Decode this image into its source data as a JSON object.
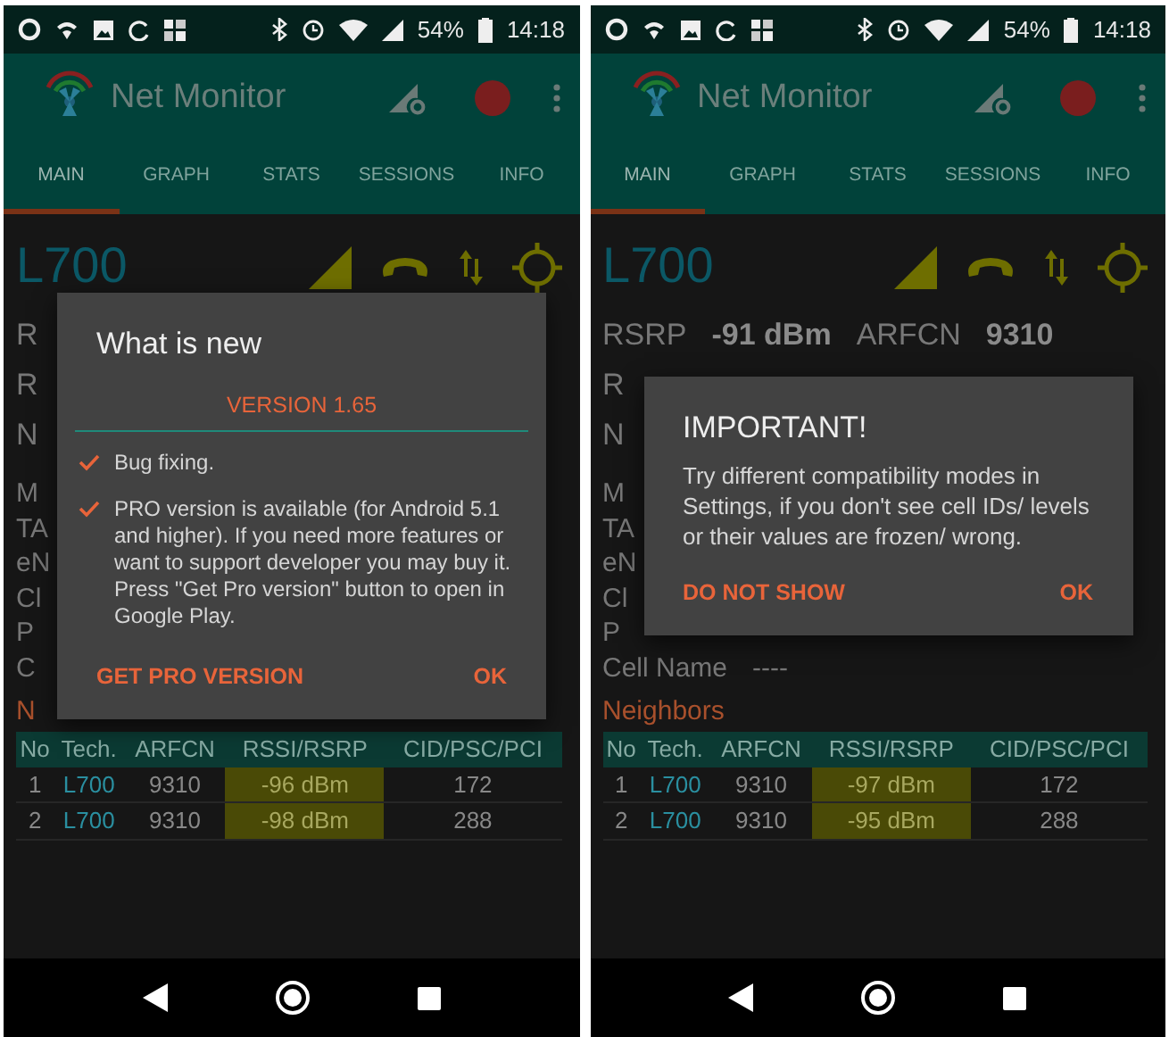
{
  "phones": [
    {
      "status_bar": {
        "battery": "54%",
        "time": "14:18"
      },
      "app_bar": {
        "title": "Net Monitor"
      },
      "tabs": [
        {
          "label": "MAIN",
          "selected": true
        },
        {
          "label": "GRAPH",
          "selected": false
        },
        {
          "label": "STATS",
          "selected": false
        },
        {
          "label": "SESSIONS",
          "selected": false
        },
        {
          "label": "INFO",
          "selected": false
        }
      ],
      "cell": {
        "tech": "L700"
      },
      "info_lines": [
        {
          "kind": "primary",
          "parts": [
            {
              "kind": "label",
              "text": "R"
            }
          ]
        },
        {
          "kind": "primary",
          "parts": [
            {
              "kind": "label",
              "text": "R"
            }
          ]
        },
        {
          "kind": "primary",
          "parts": [
            {
              "kind": "label",
              "text": "N"
            }
          ]
        },
        {
          "kind": "secondary",
          "parts": [
            {
              "kind": "label",
              "text": "M"
            }
          ]
        },
        {
          "kind": "secondary",
          "parts": [
            {
              "kind": "label",
              "text": "TA"
            }
          ]
        },
        {
          "kind": "secondary",
          "parts": [
            {
              "kind": "label",
              "text": "eN"
            }
          ]
        },
        {
          "kind": "secondary",
          "parts": [
            {
              "kind": "label",
              "text": "Cl"
            }
          ]
        },
        {
          "kind": "secondary",
          "parts": [
            {
              "kind": "label",
              "text": "P"
            }
          ]
        },
        {
          "kind": "secondary",
          "parts": [
            {
              "kind": "label",
              "text": "C"
            }
          ]
        }
      ],
      "neighbors": {
        "title": "N",
        "columns": [
          "No",
          "Tech.",
          "ARFCN",
          "RSSI/RSRP",
          "CID/PSC/PCI"
        ],
        "rows": [
          [
            "1",
            "L700",
            "9310",
            "-96 dBm",
            "172"
          ],
          [
            "2",
            "L700",
            "9310",
            "-98 dBm",
            "288"
          ]
        ]
      },
      "dialog": {
        "title": "What is new",
        "version": "VERSION 1.65",
        "items": [
          "Bug fixing.",
          "PRO version is available (for Android 5.1 and higher). If you need more features or want to support developer you may buy it. Press \"Get Pro version\" button to open in Google Play."
        ],
        "buttons": [
          "GET PRO VERSION",
          "OK"
        ]
      }
    },
    {
      "status_bar": {
        "battery": "54%",
        "time": "14:18"
      },
      "app_bar": {
        "title": "Net Monitor"
      },
      "tabs": [
        {
          "label": "MAIN",
          "selected": true
        },
        {
          "label": "GRAPH",
          "selected": false
        },
        {
          "label": "STATS",
          "selected": false
        },
        {
          "label": "SESSIONS",
          "selected": false
        },
        {
          "label": "INFO",
          "selected": false
        }
      ],
      "cell": {
        "tech": "L700"
      },
      "info_lines": [
        {
          "kind": "primary",
          "parts": [
            {
              "kind": "label",
              "text": "RSRP"
            },
            {
              "kind": "value",
              "text": "-91 dBm"
            },
            {
              "kind": "label",
              "text": "ARFCN"
            },
            {
              "kind": "value",
              "text": "9310"
            }
          ]
        },
        {
          "kind": "primary",
          "parts": [
            {
              "kind": "label",
              "text": "R"
            }
          ]
        },
        {
          "kind": "primary",
          "parts": [
            {
              "kind": "label",
              "text": "N"
            }
          ]
        },
        {
          "kind": "secondary",
          "parts": [
            {
              "kind": "label",
              "text": "M"
            }
          ]
        },
        {
          "kind": "secondary",
          "parts": [
            {
              "kind": "label",
              "text": "TA"
            }
          ]
        },
        {
          "kind": "secondary",
          "parts": [
            {
              "kind": "label",
              "text": "eN"
            }
          ]
        },
        {
          "kind": "secondary",
          "parts": [
            {
              "kind": "label",
              "text": "Cl"
            }
          ]
        },
        {
          "kind": "secondary",
          "parts": [
            {
              "kind": "label",
              "text": "P"
            }
          ]
        },
        {
          "kind": "secondary",
          "parts": [
            {
              "kind": "label",
              "text": "Cell Name"
            },
            {
              "kind": "label",
              "text": "----"
            }
          ]
        }
      ],
      "neighbors": {
        "title": "Neighbors",
        "columns": [
          "No",
          "Tech.",
          "ARFCN",
          "RSSI/RSRP",
          "CID/PSC/PCI"
        ],
        "rows": [
          [
            "1",
            "L700",
            "9310",
            "-97 dBm",
            "172"
          ],
          [
            "2",
            "L700",
            "9310",
            "-95 dBm",
            "288"
          ]
        ]
      },
      "dialog": {
        "title": "IMPORTANT!",
        "body": "Try different compatibility modes in Settings, if you don't see cell IDs/ levels or their values are frozen/ wrong.",
        "buttons": [
          "DO NOT SHOW",
          "OK"
        ]
      }
    }
  ]
}
